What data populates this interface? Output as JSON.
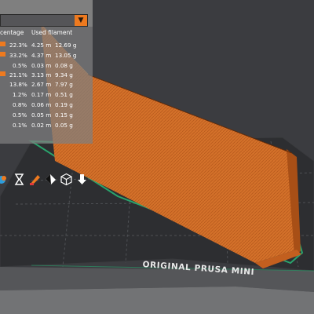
{
  "legend": {
    "headers": {
      "percentage": "centage",
      "used_filament": "Used filament"
    },
    "rows": [
      {
        "color": "#ee7a1f",
        "percent": "22.3%",
        "length": "4.25 m",
        "weight": "12.69 g"
      },
      {
        "color": "#ee7a1f",
        "percent": "33.2%",
        "length": "4.37 m",
        "weight": "13.05 g"
      },
      {
        "color": "",
        "percent": "0.5%",
        "length": "0.03 m",
        "weight": "0.08 g"
      },
      {
        "color": "#ee7a1f",
        "percent": "21.1%",
        "length": "3.13 m",
        "weight": "9.34 g"
      },
      {
        "color": "",
        "percent": "13.8%",
        "length": "2.67 m",
        "weight": "7.97 g"
      },
      {
        "color": "",
        "percent": "1.2%",
        "length": "0.17 m",
        "weight": "0.51 g"
      },
      {
        "color": "",
        "percent": "0.8%",
        "length": "0.06 m",
        "weight": "0.19 g"
      },
      {
        "color": "",
        "percent": "0.5%",
        "length": "0.05 m",
        "weight": "0.15 g"
      },
      {
        "color": "",
        "percent": "0.1%",
        "length": "0.02 m",
        "weight": "0.05 g"
      }
    ]
  },
  "bed": {
    "label": "ORIGINAL PRUSA MINI"
  },
  "colors": {
    "accent": "#ee7a1f",
    "bed": "#2d2e31",
    "background": "#3b3c40",
    "object": "#d4712a"
  },
  "toolbar": {
    "icons": [
      "support-paint-icon",
      "seam-paint-icon",
      "hourglass-icon",
      "color-paint-icon",
      "cut-icon",
      "box-icon",
      "download-icon"
    ]
  }
}
